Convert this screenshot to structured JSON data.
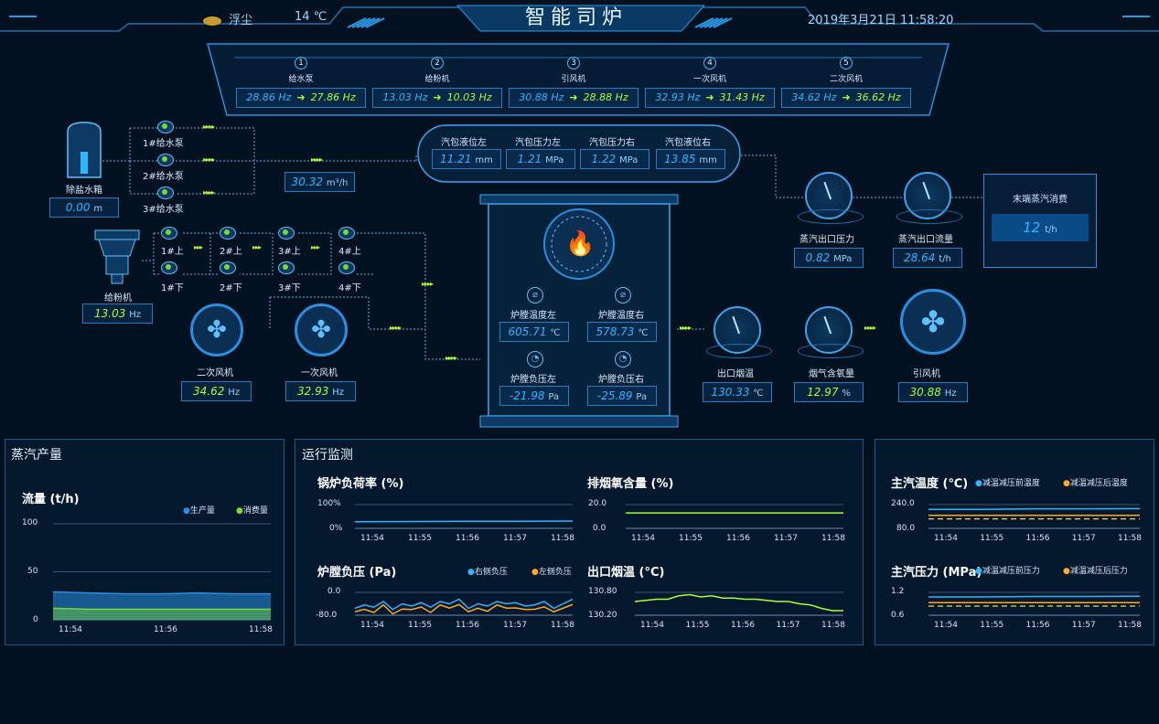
{
  "header": {
    "title": "智能司炉",
    "weather": "浮尘",
    "temperature": "14 ℃",
    "datetime": "2019年3月21日 11:58:20"
  },
  "top": [
    {
      "num": "1",
      "label": "给水泵",
      "from": "28.86 Hz",
      "to": "27.86 Hz"
    },
    {
      "num": "2",
      "label": "给粉机",
      "from": "13.03 Hz",
      "to": "10.03 Hz"
    },
    {
      "num": "3",
      "label": "引风机",
      "from": "30.88 Hz",
      "to": "28.88 Hz"
    },
    {
      "num": "4",
      "label": "一次风机",
      "from": "32.93 Hz",
      "to": "31.43 Hz"
    },
    {
      "num": "5",
      "label": "二次风机",
      "from": "34.62 Hz",
      "to": "36.62 Hz"
    }
  ],
  "tank": {
    "label": "除盐水箱",
    "value": "0.00",
    "unit": "m"
  },
  "pumps": [
    "1#给水泵",
    "2#给水泵",
    "3#给水泵"
  ],
  "flow": {
    "value": "30.32",
    "unit": "m³/h"
  },
  "drum": [
    {
      "label": "汽包液位左",
      "value": "11.21",
      "unit": "mm"
    },
    {
      "label": "汽包压力左",
      "value": "1.21",
      "unit": "MPa"
    },
    {
      "label": "汽包压力右",
      "value": "1.22",
      "unit": "MPa"
    },
    {
      "label": "汽包液位右",
      "value": "13.85",
      "unit": "mm"
    }
  ],
  "feeder": {
    "label": "给粉机",
    "value": "13.03",
    "unit": "Hz"
  },
  "burners": {
    "up": [
      "1#上",
      "2#上",
      "3#上",
      "4#上"
    ],
    "down": [
      "1#下",
      "2#下",
      "3#下",
      "4#下"
    ]
  },
  "fans": [
    {
      "label": "二次风机",
      "value": "34.62",
      "unit": "Hz"
    },
    {
      "label": "一次风机",
      "value": "32.93",
      "unit": "Hz"
    }
  ],
  "furnace": [
    {
      "label": "炉膛温度左",
      "value": "605.71",
      "unit": "℃"
    },
    {
      "label": "炉膛温度右",
      "value": "578.73",
      "unit": "℃"
    },
    {
      "label": "炉膛负压左",
      "value": "-21.98",
      "unit": "Pa"
    },
    {
      "label": "炉膛负压右",
      "value": "-25.89",
      "unit": "Pa"
    }
  ],
  "gauges_top": [
    {
      "label": "蒸汽出口压力",
      "value": "0.82",
      "unit": "MPa"
    },
    {
      "label": "蒸汽出口流量",
      "value": "28.64",
      "unit": "t/h"
    }
  ],
  "end_steam": {
    "label": "末端蒸汽消费",
    "value": "12",
    "unit": "t/h"
  },
  "gauges_bottom": [
    {
      "label": "出口烟温",
      "value": "130.33",
      "unit": "℃"
    },
    {
      "label": "烟气含氧量",
      "value": "12.97",
      "unit": "%"
    },
    {
      "label": "引风机",
      "value": "30.88",
      "unit": "Hz"
    }
  ],
  "panels": {
    "steam": "蒸汽产量",
    "monitor": "运行监测"
  },
  "chart_data": [
    {
      "type": "area",
      "title": "流量 (t/h)",
      "x": [
        "11:54",
        "11:56",
        "11:58"
      ],
      "ylim": [
        0,
        100
      ],
      "yticks": [
        "100",
        "50",
        "0"
      ],
      "series": [
        {
          "name": "生产量",
          "color": "#2a8fe0",
          "values": [
            29,
            28,
            27,
            27,
            28,
            27,
            27
          ]
        },
        {
          "name": "消费量",
          "color": "#7bd63a",
          "values": [
            12,
            11,
            11,
            11,
            11,
            11,
            11
          ]
        }
      ]
    },
    {
      "type": "line",
      "title": "锅炉负荷率 (%)",
      "x": [
        "11:54",
        "11:55",
        "11:56",
        "11:57",
        "11:58"
      ],
      "yticks": [
        "100%",
        "0%"
      ],
      "series": [
        {
          "color": "#2fb6ff",
          "values": [
            28,
            29,
            30,
            30,
            31
          ]
        }
      ]
    },
    {
      "type": "line",
      "title": "排烟氧含量 (%)",
      "x": [
        "11:54",
        "11:55",
        "11:56",
        "11:57",
        "11:58"
      ],
      "yticks": [
        "20.0",
        "0.0"
      ],
      "series": [
        {
          "color": "#a6ff3c",
          "values": [
            13,
            13,
            13,
            13,
            13
          ]
        }
      ]
    },
    {
      "type": "line",
      "title": "炉膛负压 (Pa)",
      "x": [
        "11:54",
        "11:55",
        "11:56",
        "11:57",
        "11:58"
      ],
      "yticks": [
        "0.0",
        "-80.0"
      ],
      "series": [
        {
          "name": "右侧负压",
          "color": "#2fb6ff"
        },
        {
          "name": "左侧负压",
          "color": "#ffa726"
        }
      ]
    },
    {
      "type": "line",
      "title": "出口烟温 (°C)",
      "x": [
        "11:54",
        "11:55",
        "11:56",
        "11:57",
        "11:58"
      ],
      "yticks": [
        "130.80",
        "130.20"
      ],
      "series": [
        {
          "color": "#a6ff3c"
        }
      ]
    },
    {
      "type": "line",
      "title": "主汽温度 (℃)",
      "x": [
        "11:54",
        "11:55",
        "11:56",
        "11:57",
        "11:58"
      ],
      "yticks": [
        "240.0",
        "80.0"
      ],
      "series": [
        {
          "name": "减温减压前温度",
          "color": "#2fb6ff"
        },
        {
          "name": "减温减压后温度",
          "color": "#ffa726"
        }
      ]
    },
    {
      "type": "line",
      "title": "主汽压力 (MPa)",
      "x": [
        "11:54",
        "11:55",
        "11:56",
        "11:57",
        "11:58"
      ],
      "yticks": [
        "1.2",
        "0.6"
      ],
      "series": [
        {
          "name": "减温减压前压力",
          "color": "#2fb6ff"
        },
        {
          "name": "减温减压后压力",
          "color": "#ffa726"
        }
      ]
    }
  ]
}
